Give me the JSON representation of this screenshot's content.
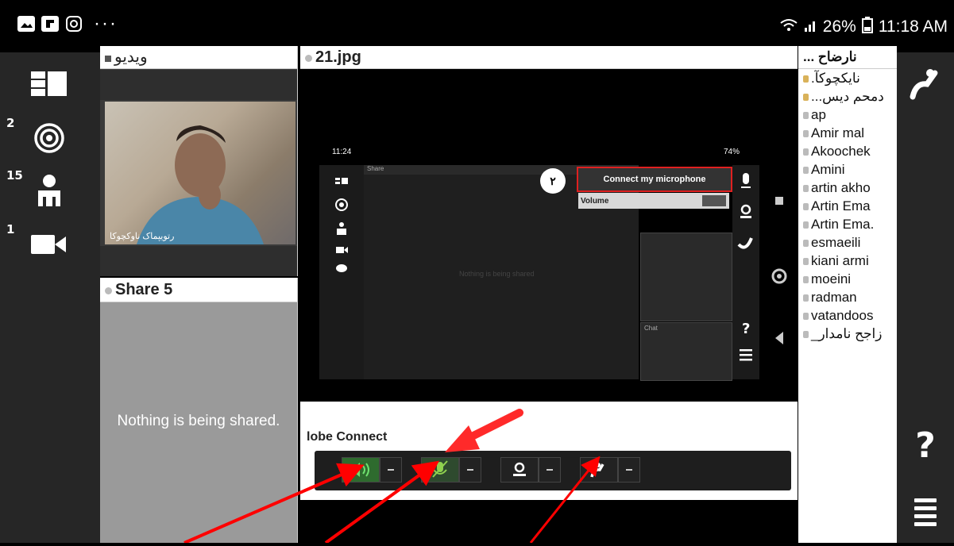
{
  "statusbar": {
    "dots": "···",
    "battery": "26%",
    "time": "11:18 AM"
  },
  "leftrail": {
    "badges": [
      "2",
      "15",
      "1"
    ],
    "icons": [
      "layout-icon",
      "broadcast-icon",
      "attendee-icon",
      "camera-icon"
    ]
  },
  "video_pod": {
    "title": "ويديو",
    "caption": "رتويپماک ناوکچوکا"
  },
  "share5": {
    "title": "Share 5",
    "message": "Nothing is being shared."
  },
  "share21": {
    "title": "21.jpg"
  },
  "inner_screen": {
    "time": "11:24",
    "battery": "74%",
    "share_label": "Share",
    "circle_number": "۲",
    "connect_button": "Connect my microphone",
    "volume_label": "Volume",
    "chat_label": "Chat",
    "nothing_shared": "Nothing is being shared",
    "adobe_label": "lobe Connect"
  },
  "attendees": {
    "title": "... نارضاح",
    "items": [
      {
        "name": ".نایکچوکآ",
        "role": "host"
      },
      {
        "name": "...دمحم دیس",
        "role": "host"
      },
      {
        "name": "ap",
        "role": "presenter"
      },
      {
        "name": "Amir mal",
        "role": "participant"
      },
      {
        "name": "Akoochek",
        "role": "participant"
      },
      {
        "name": "Amini",
        "role": "participant"
      },
      {
        "name": "artin akho",
        "role": "participant"
      },
      {
        "name": "Artin Ema",
        "role": "participant"
      },
      {
        "name": "Artin Ema.",
        "role": "participant"
      },
      {
        "name": "esmaeili",
        "role": "participant"
      },
      {
        "name": "kiani armi",
        "role": "participant"
      },
      {
        "name": "moeini",
        "role": "participant"
      },
      {
        "name": "radman",
        "role": "participant"
      },
      {
        "name": "vatandoos",
        "role": "participant"
      },
      {
        "name": "_زاجح نامدار",
        "role": "participant"
      }
    ]
  },
  "rightrail": {
    "help_label": "?"
  },
  "colors": {
    "rail": "#262626",
    "annotation_arrow": "#ff0000",
    "speaker_green": "#39b54a"
  }
}
